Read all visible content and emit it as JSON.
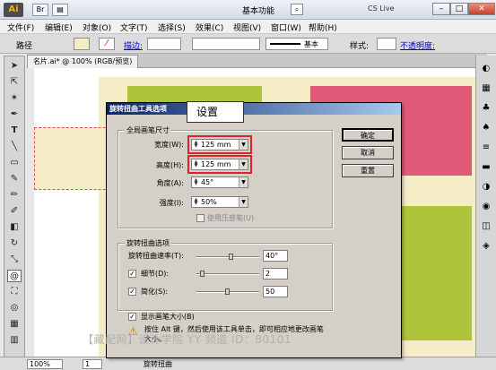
{
  "app": {
    "logo": "Ai",
    "mode_buttons": [
      "Br",
      "▤"
    ],
    "workspace": "基本功能",
    "cslive": "CS Live"
  },
  "window_buttons": [
    "–",
    "□",
    "✕"
  ],
  "menu": [
    "文件(F)",
    "编辑(E)",
    "对象(O)",
    "文字(T)",
    "选择(S)",
    "效果(C)",
    "视图(V)",
    "窗口(W)",
    "帮助(H)"
  ],
  "control": {
    "path_label": "路径",
    "stroke_label": "描边:",
    "stroke_basic": "基本",
    "style_label": "样式:",
    "opacity_label": "不透明度:"
  },
  "doc_tab": "名片.ai* @ 100% (RGB/预览)",
  "status": {
    "zoom": "100%",
    "page": "1",
    "tool": "旋转扭曲"
  },
  "dialog": {
    "title": "旋转扭曲工具选项",
    "group1_title": "全局画笔尺寸",
    "width_label": "宽度(W):",
    "width_value": "125 mm",
    "height_label": "高度(H):",
    "height_value": "125 mm",
    "angle_label": "角度(A):",
    "angle_value": "45°",
    "intensity_label": "强度(I):",
    "intensity_value": "50%",
    "pressure_label": "使用压感笔(U)",
    "group2_title": "旋转扭曲选项",
    "rate_label": "旋转扭曲速率(T):",
    "rate_value": "40°",
    "detail_label": "细节(D):",
    "detail_value": "2",
    "simplify_label": "简化(S):",
    "simplify_value": "50",
    "show_brush_label": "显示画笔大小(B)",
    "tip": "按住 Alt 键，然后使用该工具单击，即可相应地更改画笔大小。",
    "ok": "确定",
    "cancel": "取消",
    "reset": "重置"
  },
  "callout": "设置",
  "watermark": "【藏配网】设计学院 YY 频道 ID：80101",
  "colors": {
    "lime": "#aec43a",
    "pink": "#e05a78",
    "cream": "#f5ecc8",
    "title_blue": "#0a246a"
  }
}
